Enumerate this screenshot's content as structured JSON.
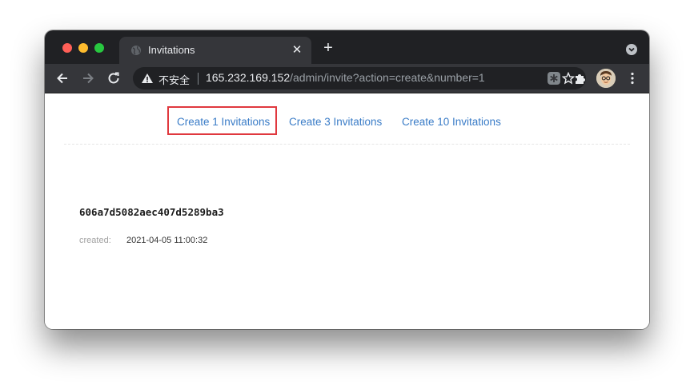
{
  "browser": {
    "tab": {
      "title": "Invitations",
      "close_glyph": "✕",
      "icon": "globe-icon"
    },
    "new_tab_glyph": "+",
    "address_bar": {
      "security_label": "不安全",
      "url_host": "165.232.169.152",
      "url_path": "/admin/invite?action=create&number=1"
    },
    "colors": {
      "tab_strip": "#202124",
      "toolbar": "#35363a",
      "omnibox": "#202124"
    }
  },
  "page": {
    "nav": {
      "links": [
        {
          "label": "Create 1 Invitations"
        },
        {
          "label": "Create 3 Invitations"
        },
        {
          "label": "Create 10 Invitations"
        }
      ],
      "link_color": "#3a7cc7",
      "highlight_color": "#e0383e"
    },
    "invitation": {
      "code": "606a7d5082aec407d5289ba3",
      "created_label": "created:",
      "created_value": "2021-04-05 11:00:32"
    }
  }
}
